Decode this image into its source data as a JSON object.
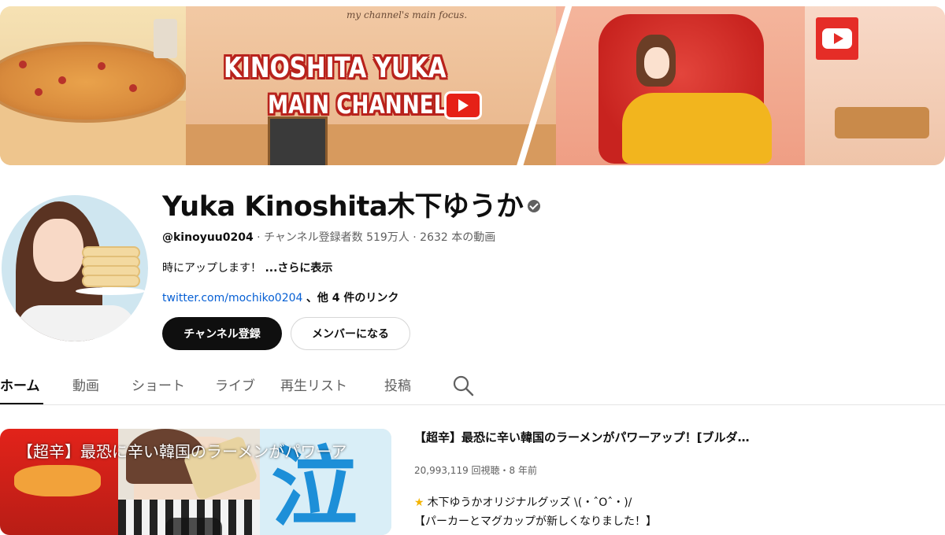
{
  "banner": {
    "logo_line1": "KINOSHITA YUKA",
    "logo_line2": "MAIN CHANNEL",
    "caption": "my channel's main focus."
  },
  "channel": {
    "name": "Yuka Kinoshita木下ゆうか",
    "handle": "@kinoyuu0204",
    "stats": " · チャンネル登録者数 519万人 · 2632 本の動画",
    "description": "時にアップします！",
    "more_label": "...さらに表示",
    "link_text": "twitter.com/mochiko0204",
    "links_extra": "、他 4 件のリンク",
    "verified_icon": "verified-check-icon"
  },
  "buttons": {
    "subscribe": "チャンネル登録",
    "member": "メンバーになる"
  },
  "tabs": [
    {
      "label": "ホーム",
      "active": true
    },
    {
      "label": "動画",
      "active": false
    },
    {
      "label": "ショート",
      "active": false
    },
    {
      "label": "ライブ",
      "active": false
    },
    {
      "label": "再生リスト",
      "active": false
    },
    {
      "label": "投稿",
      "active": false
    }
  ],
  "featured": {
    "thumb_title": "【超辛】最恐に辛い韓国のラーメンがパワーア",
    "thumb_kanji": "泣",
    "title": "【超辛】最恐に辛い韓国のラーメンがパワーアップ！[ブルダ…",
    "meta": "20,993,119 回視聴・8 年前",
    "desc_line1": "木下ゆうかオリジナルグッズ \\(・ˆOˆ・)/",
    "desc_line2": "【パーカーとマグカップが新しくなりました！】"
  },
  "colors": {
    "subscribe_bg": "#0f0f0f",
    "link": "#065fd4",
    "brand_red": "#e52d27"
  }
}
